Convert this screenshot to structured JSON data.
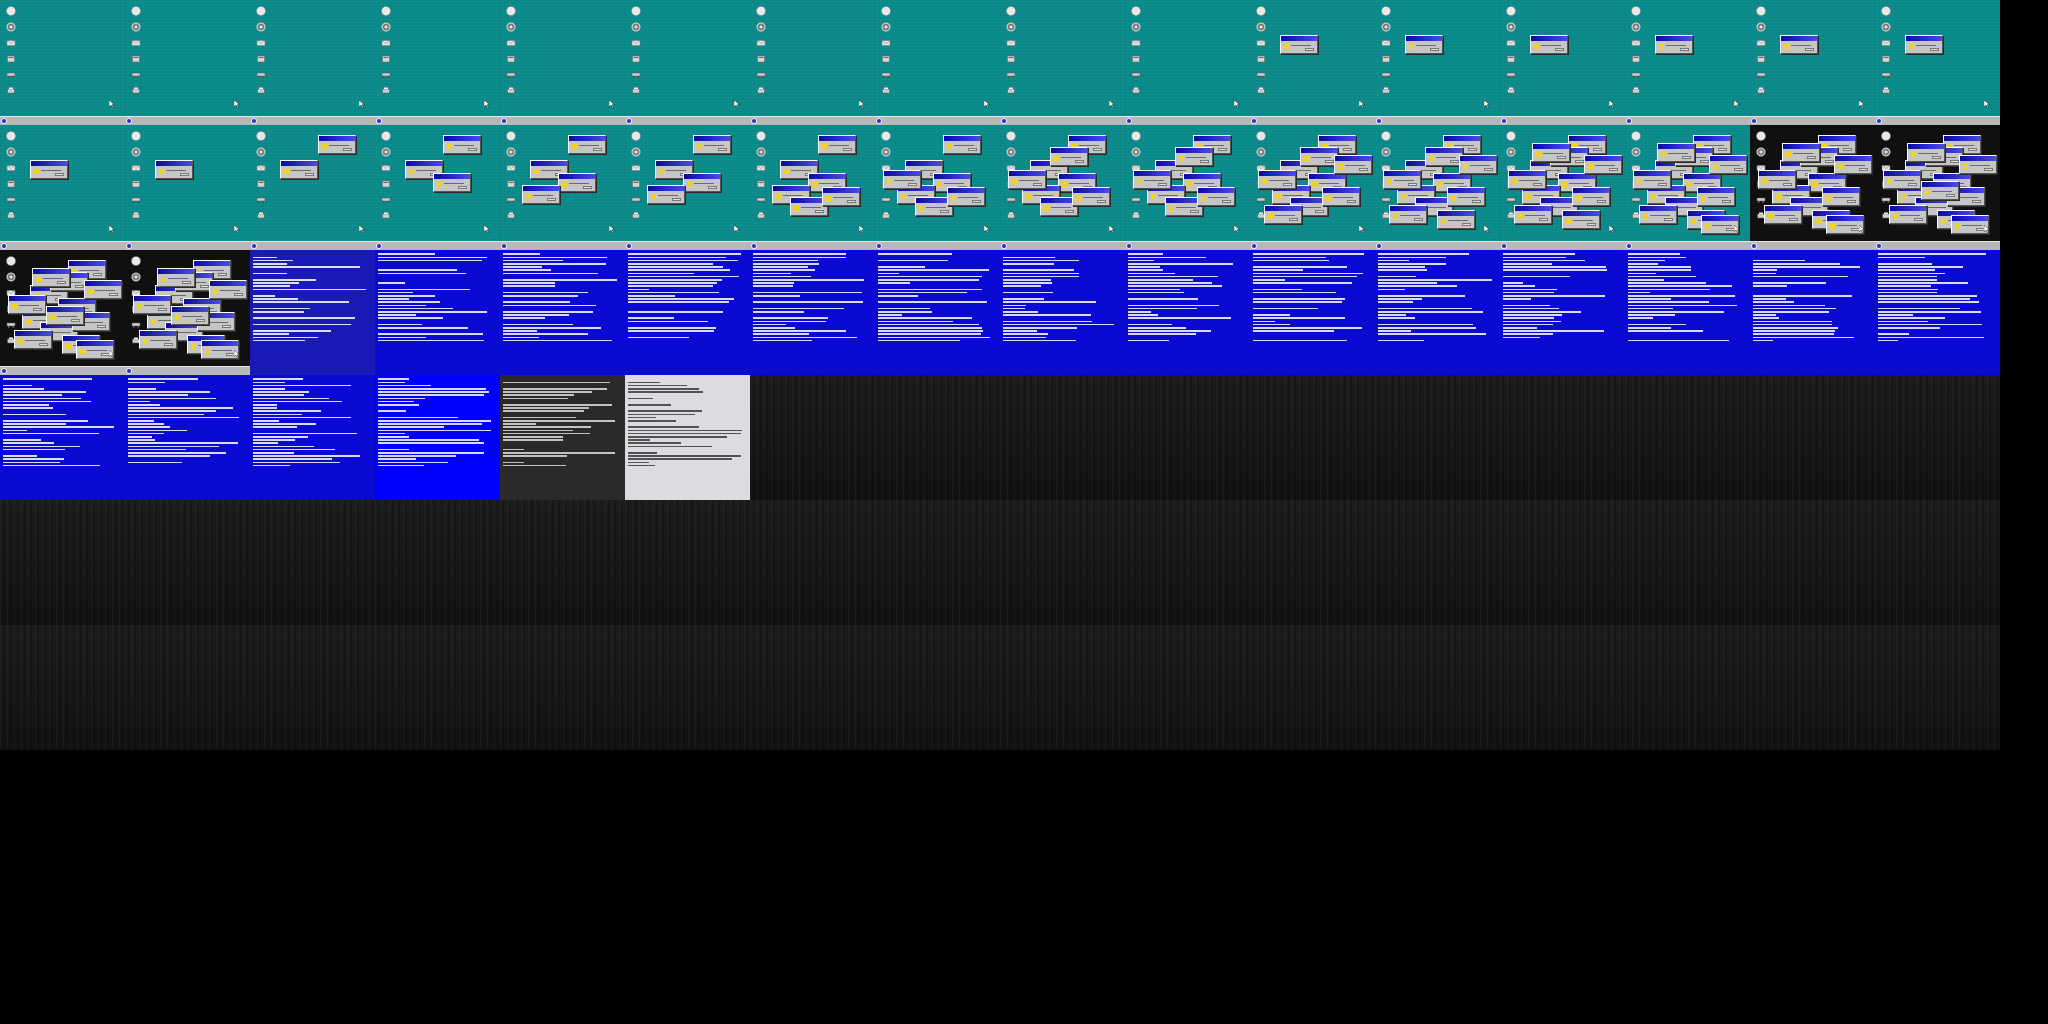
{
  "sheet": {
    "columns": 16,
    "frames": [
      {
        "kind": "desktop",
        "dialogs": 0
      },
      {
        "kind": "desktop",
        "dialogs": 0
      },
      {
        "kind": "desktop",
        "dialogs": 0
      },
      {
        "kind": "desktop",
        "dialogs": 0
      },
      {
        "kind": "desktop",
        "dialogs": 0
      },
      {
        "kind": "desktop",
        "dialogs": 0
      },
      {
        "kind": "desktop",
        "dialogs": 0
      },
      {
        "kind": "desktop",
        "dialogs": 0
      },
      {
        "kind": "desktop",
        "dialogs": 0
      },
      {
        "kind": "desktop",
        "dialogs": 0
      },
      {
        "kind": "desktop",
        "dialogs": 1
      },
      {
        "kind": "desktop",
        "dialogs": 1
      },
      {
        "kind": "desktop",
        "dialogs": 1
      },
      {
        "kind": "desktop",
        "dialogs": 1
      },
      {
        "kind": "desktop",
        "dialogs": 1
      },
      {
        "kind": "desktop",
        "dialogs": 1
      },
      {
        "kind": "desktop",
        "dialogs": 1
      },
      {
        "kind": "desktop",
        "dialogs": 1
      },
      {
        "kind": "desktop",
        "dialogs": 2
      },
      {
        "kind": "desktop",
        "dialogs": 3
      },
      {
        "kind": "desktop",
        "dialogs": 4
      },
      {
        "kind": "desktop",
        "dialogs": 4
      },
      {
        "kind": "desktop",
        "dialogs": 6
      },
      {
        "kind": "desktop",
        "dialogs": 7
      },
      {
        "kind": "desktop",
        "dialogs": 8
      },
      {
        "kind": "desktop",
        "dialogs": 8
      },
      {
        "kind": "desktop",
        "dialogs": 10
      },
      {
        "kind": "desktop",
        "dialogs": 11
      },
      {
        "kind": "desktop",
        "dialogs": 12
      },
      {
        "kind": "desktop",
        "dialogs": 13
      },
      {
        "kind": "desktop-dark",
        "dialogs": 13
      },
      {
        "kind": "desktop-dark",
        "dialogs": 14
      },
      {
        "kind": "desktop-dark",
        "dialogs": 14
      },
      {
        "kind": "desktop-dark",
        "dialogs": 14
      },
      {
        "kind": "crash-faded"
      },
      {
        "kind": "crash"
      },
      {
        "kind": "crash"
      },
      {
        "kind": "crash"
      },
      {
        "kind": "crash"
      },
      {
        "kind": "crash"
      },
      {
        "kind": "crash"
      },
      {
        "kind": "crash"
      },
      {
        "kind": "crash"
      },
      {
        "kind": "crash"
      },
      {
        "kind": "crash"
      },
      {
        "kind": "crash"
      },
      {
        "kind": "crash"
      },
      {
        "kind": "crash"
      },
      {
        "kind": "crash"
      },
      {
        "kind": "crash"
      },
      {
        "kind": "crash"
      },
      {
        "kind": "crash-bright"
      },
      {
        "kind": "crash-gray"
      },
      {
        "kind": "crash-light"
      },
      {
        "kind": "static"
      },
      {
        "kind": "static"
      },
      {
        "kind": "static"
      },
      {
        "kind": "static"
      },
      {
        "kind": "static"
      },
      {
        "kind": "static"
      },
      {
        "kind": "static"
      },
      {
        "kind": "static"
      },
      {
        "kind": "static"
      },
      {
        "kind": "static"
      },
      {
        "kind": "static"
      },
      {
        "kind": "static"
      },
      {
        "kind": "static"
      },
      {
        "kind": "static"
      },
      {
        "kind": "static"
      },
      {
        "kind": "static"
      },
      {
        "kind": "static"
      },
      {
        "kind": "static"
      },
      {
        "kind": "static"
      },
      {
        "kind": "static"
      },
      {
        "kind": "static"
      },
      {
        "kind": "static"
      },
      {
        "kind": "static"
      },
      {
        "kind": "static"
      },
      {
        "kind": "static"
      },
      {
        "kind": "static"
      },
      {
        "kind": "static"
      },
      {
        "kind": "static"
      },
      {
        "kind": "static"
      },
      {
        "kind": "static"
      },
      {
        "kind": "static"
      },
      {
        "kind": "static"
      },
      {
        "kind": "static"
      },
      {
        "kind": "static"
      },
      {
        "kind": "static"
      },
      {
        "kind": "static"
      },
      {
        "kind": "static"
      },
      {
        "kind": "static"
      },
      {
        "kind": "static"
      },
      {
        "kind": "static"
      },
      {
        "kind": "static"
      },
      {
        "kind": "static"
      }
    ]
  },
  "desktop": {
    "icons": [
      "computer-icon",
      "recycle-icon",
      "mail-icon",
      "folder-icon",
      "network-icon",
      "printer-icon"
    ]
  },
  "colors": {
    "desktop_teal": "#0b8a8a",
    "crash_blue": "#0a0ad2",
    "taskbar_gray": "#b8b8b8",
    "dialog_title_blue": "#0a0aa0",
    "warning_yellow": "#f2d21a"
  }
}
